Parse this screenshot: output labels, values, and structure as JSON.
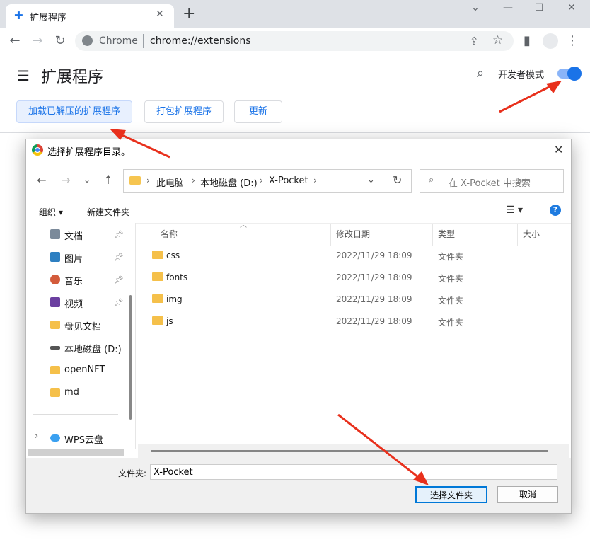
{
  "browser": {
    "tab_title": "扩展程序",
    "new_tab": "+",
    "omnibox_label": "Chrome",
    "url": "chrome://extensions"
  },
  "extensions_page": {
    "title": "扩展程序",
    "dev_mode_label": "开发者模式",
    "dev_mode_on": true,
    "buttons": {
      "load_unpacked": "加载已解压的扩展程序",
      "pack": "打包扩展程序",
      "update": "更新"
    }
  },
  "dialog": {
    "title": "选择扩展程序目录。",
    "breadcrumb": [
      "此电脑",
      "本地磁盘 (D:)",
      "X-Pocket"
    ],
    "search_placeholder": "在 X-Pocket 中搜索",
    "organize": "组织 ▾",
    "new_folder": "新建文件夹",
    "sidebar": {
      "items": [
        {
          "label": "文档",
          "icon": "documents-icon",
          "pinned": true
        },
        {
          "label": "图片",
          "icon": "pictures-icon",
          "pinned": true
        },
        {
          "label": "音乐",
          "icon": "music-icon",
          "pinned": true
        },
        {
          "label": "视频",
          "icon": "videos-icon",
          "pinned": true
        },
        {
          "label": "盘见文档",
          "icon": "folder-icon",
          "pinned": false
        },
        {
          "label": "本地磁盘 (D:)",
          "icon": "drive-icon",
          "pinned": false
        },
        {
          "label": "openNFT",
          "icon": "folder-icon",
          "pinned": false
        },
        {
          "label": "md",
          "icon": "folder-icon",
          "pinned": false
        }
      ],
      "cloud": "WPS云盘"
    },
    "columns": {
      "name": "名称",
      "date": "修改日期",
      "type": "类型",
      "size": "大小"
    },
    "files": [
      {
        "name": "css",
        "date": "2022/11/29 18:09",
        "type": "文件夹"
      },
      {
        "name": "fonts",
        "date": "2022/11/29 18:09",
        "type": "文件夹"
      },
      {
        "name": "img",
        "date": "2022/11/29 18:09",
        "type": "文件夹"
      },
      {
        "name": "js",
        "date": "2022/11/29 18:09",
        "type": "文件夹"
      }
    ],
    "folder_label": "文件夹:",
    "folder_value": "X-Pocket",
    "select_button": "选择文件夹",
    "cancel_button": "取消"
  },
  "colors": {
    "accent": "#1a73e8",
    "arrow": "#e8301c",
    "folder": "#f5c04a"
  }
}
